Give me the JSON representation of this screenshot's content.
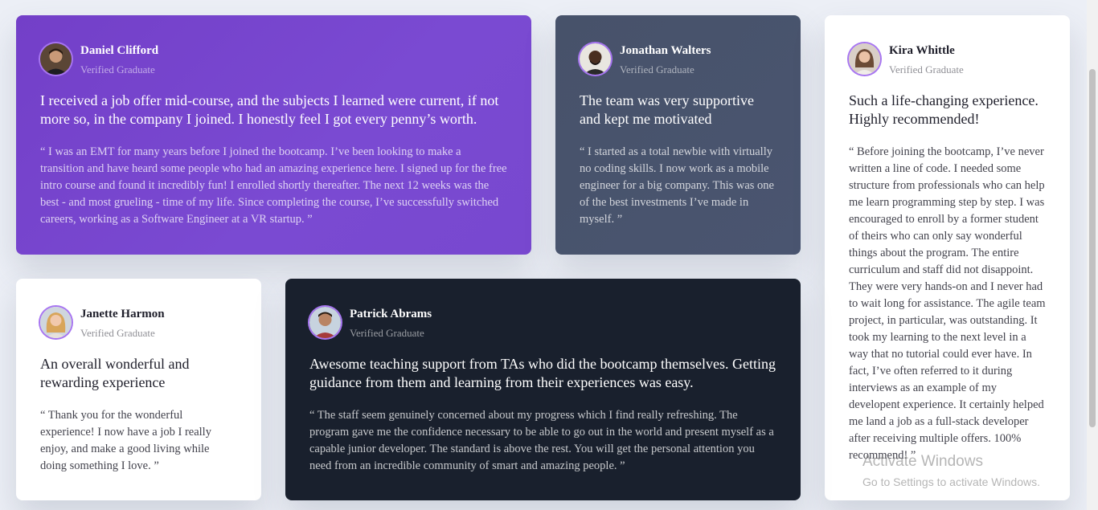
{
  "testimonials": {
    "daniel": {
      "name": "Daniel Clifford",
      "role": "Verified Graduate",
      "headline": "I received a job offer mid-course, and the subjects I learned were current, if not more so, in the company I joined. I honestly feel I got every penny’s worth.",
      "quote": "“ I was an EMT for many years before I joined the bootcamp. I’ve been looking to make a transition and have heard some people who had an amazing experience here. I signed up for the free intro course and found it incredibly fun! I enrolled shortly thereafter. The next 12 weeks was the best - and most grueling - time of my life. Since completing the course, I’ve successfully switched careers, working as a Software Engineer at a VR startup. ”"
    },
    "jonathan": {
      "name": "Jonathan Walters",
      "role": "Verified Graduate",
      "headline": "The team was very supportive and kept me motivated",
      "quote": "“ I started as a total newbie with virtually no coding skills. I now work as a mobile engineer for a big company. This was one of the best investments I’ve made in myself. ”"
    },
    "kira": {
      "name": "Kira Whittle",
      "role": "Verified Graduate",
      "headline": "Such a life-changing experience. Highly recommended!",
      "quote": "“ Before joining the bootcamp, I’ve never written a line of code. I needed some structure from professionals who can help me learn programming step by step. I was encouraged to enroll by a former student of theirs who can only say wonderful things about the program. The entire curriculum and staff did not disappoint. They were very hands-on and I never had to wait long for assistance. The agile team project, in particular, was outstanding. It took my learning to the next level in a way that no tutorial could ever have. In fact, I’ve often referred to it during interviews as an example of my developent experience. It certainly helped me land a job as a full-stack developer after receiving multiple offers. 100% recommend! ”"
    },
    "janette": {
      "name": "Janette Harmon",
      "role": "Verified Graduate",
      "headline": "An overall wonderful and rewarding experience",
      "quote": "“ Thank you for the wonderful experience! I now have a job I really enjoy, and make a good living while doing something I love. ”"
    },
    "patrick": {
      "name": "Patrick Abrams",
      "role": "Verified Graduate",
      "headline": "Awesome teaching support from TAs who did the bootcamp themselves. Getting guidance from them and learning from their experiences was easy.",
      "quote": "“ The staff seem genuinely concerned about my progress which I find really refreshing. The program gave me the confidence necessary to be able to go out in the world and present myself as a capable junior developer. The standard is above the rest. You will get the personal attention you need from an incredible community of smart and amazing people. ”"
    }
  },
  "watermark": {
    "title": "Activate Windows",
    "subtitle": "Go to Settings to activate Windows."
  },
  "colors": {
    "violet": "#733fc8",
    "grayish_blue": "#48556a",
    "blackish_blue": "#19202d",
    "white": "#ffffff",
    "avatar_ring": "#a775f1"
  }
}
